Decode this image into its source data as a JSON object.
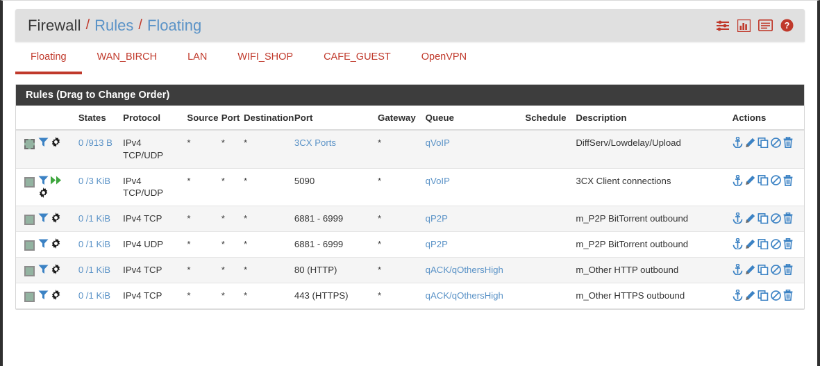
{
  "breadcrumb": {
    "root": "Firewall",
    "sep": "/",
    "level2": "Rules",
    "level3": "Floating",
    "icons": [
      {
        "name": "sliders-icon",
        "label": "sliders"
      },
      {
        "name": "bar-chart-icon",
        "label": "chart"
      },
      {
        "name": "list-icon",
        "label": "list"
      },
      {
        "name": "help-icon",
        "label": "help"
      }
    ]
  },
  "tabs": [
    {
      "label": "Floating",
      "active": true
    },
    {
      "label": "WAN_BIRCH",
      "active": false
    },
    {
      "label": "LAN",
      "active": false
    },
    {
      "label": "WIFI_SHOP",
      "active": false
    },
    {
      "label": "CAFE_GUEST",
      "active": false
    },
    {
      "label": "OpenVPN",
      "active": false
    }
  ],
  "panel": {
    "title": "Rules (Drag to Change Order)"
  },
  "table": {
    "headers": {
      "select": "",
      "icons": "",
      "states": "States",
      "protocol": "Protocol",
      "source": "Source",
      "source_port": "Port",
      "destination": "Destination",
      "dest_port": "Port",
      "gateway": "Gateway",
      "queue": "Queue",
      "schedule": "Schedule",
      "description": "Description",
      "actions": "Actions"
    },
    "rows": [
      {
        "indicator": "pass-dashed",
        "flags": [
          "filter-icon",
          "gear-icon"
        ],
        "states": "0 /913 B",
        "protocol": "IPv4 TCP/UDP",
        "source": "*",
        "source_port": "*",
        "destination": "*",
        "dest_port": "3CX Ports",
        "dest_port_link": true,
        "gateway": "*",
        "queue": "qVoIP",
        "queue_link": true,
        "schedule": "",
        "description": "DiffServ/Lowdelay/Upload"
      },
      {
        "indicator": "pass",
        "flags": [
          "filter-icon",
          "fast-forward-icon",
          "gear-icon"
        ],
        "states": "0 /3 KiB",
        "protocol": "IPv4 TCP/UDP",
        "source": "*",
        "source_port": "*",
        "destination": "*",
        "dest_port": "5090",
        "dest_port_link": false,
        "gateway": "*",
        "queue": "qVoIP",
        "queue_link": true,
        "schedule": "",
        "description": "3CX Client connections"
      },
      {
        "indicator": "pass",
        "flags": [
          "filter-icon",
          "gear-icon"
        ],
        "states": "0 /1 KiB",
        "protocol": "IPv4 TCP",
        "source": "*",
        "source_port": "*",
        "destination": "*",
        "dest_port": "6881 - 6999",
        "dest_port_link": false,
        "gateway": "*",
        "queue": "qP2P",
        "queue_link": true,
        "schedule": "",
        "description": "m_P2P BitTorrent outbound"
      },
      {
        "indicator": "pass",
        "flags": [
          "filter-icon",
          "gear-icon"
        ],
        "states": "0 /1 KiB",
        "protocol": "IPv4 UDP",
        "source": "*",
        "source_port": "*",
        "destination": "*",
        "dest_port": "6881 - 6999",
        "dest_port_link": false,
        "gateway": "*",
        "queue": "qP2P",
        "queue_link": true,
        "schedule": "",
        "description": "m_P2P BitTorrent outbound"
      },
      {
        "indicator": "pass",
        "flags": [
          "filter-icon",
          "gear-icon"
        ],
        "states": "0 /1 KiB",
        "protocol": "IPv4 TCP",
        "source": "*",
        "source_port": "*",
        "destination": "*",
        "dest_port": "80 (HTTP)",
        "dest_port_link": false,
        "gateway": "*",
        "queue": "qACK/qOthersHigh",
        "queue_link": true,
        "schedule": "",
        "description": "m_Other HTTP outbound"
      },
      {
        "indicator": "pass",
        "flags": [
          "filter-icon",
          "gear-icon"
        ],
        "states": "0 /1 KiB",
        "protocol": "IPv4 TCP",
        "source": "*",
        "source_port": "*",
        "destination": "*",
        "dest_port": "443 (HTTPS)",
        "dest_port_link": false,
        "gateway": "*",
        "queue": "qACK/qOthersHigh",
        "queue_link": true,
        "schedule": "",
        "description": "m_Other HTTPS outbound"
      }
    ],
    "row_actions": [
      {
        "name": "anchor-icon",
        "label": "Move"
      },
      {
        "name": "pencil-icon",
        "label": "Edit"
      },
      {
        "name": "copy-icon",
        "label": "Copy"
      },
      {
        "name": "ban-icon",
        "label": "Disable"
      },
      {
        "name": "trash-icon",
        "label": "Delete"
      }
    ]
  },
  "colors": {
    "accent_red": "#c0392b",
    "link_blue": "#5b93c7",
    "icon_blue": "#3b82c4",
    "panel_header": "#3d3d3d",
    "pass_green": "#93b3a1",
    "forward_green": "#3fa63f"
  }
}
